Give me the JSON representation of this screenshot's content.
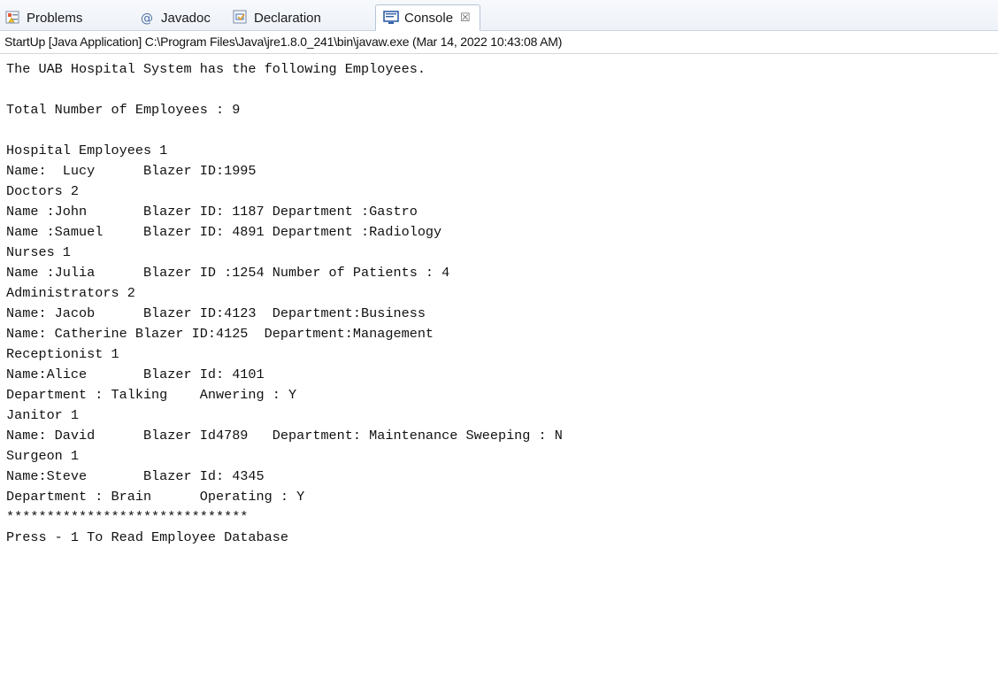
{
  "tabs": [
    {
      "label": "Problems",
      "icon": "problems-icon"
    },
    {
      "label": "Javadoc",
      "icon": "javadoc-icon"
    },
    {
      "label": "Declaration",
      "icon": "declaration-icon"
    },
    {
      "label": "Console",
      "icon": "console-icon",
      "active": true,
      "close": "☒"
    }
  ],
  "status_line": "StartUp [Java Application] C:\\Program Files\\Java\\jre1.8.0_241\\bin\\javaw.exe (Mar 14, 2022 10:43:08 AM)",
  "console_lines": [
    "The UAB Hospital System has the following Employees.",
    "",
    "Total Number of Employees : 9",
    "",
    "Hospital Employees 1",
    "Name:  Lucy      Blazer ID:1995",
    "Doctors 2",
    "Name :John       Blazer ID: 1187 Department :Gastro",
    "Name :Samuel     Blazer ID: 4891 Department :Radiology",
    "Nurses 1",
    "Name :Julia      Blazer ID :1254 Number of Patients : 4",
    "Administrators 2",
    "Name: Jacob      Blazer ID:4123  Department:Business",
    "Name: Catherine Blazer ID:4125  Department:Management",
    "Receptionist 1",
    "Name:Alice       Blazer Id: 4101",
    "Department : Talking    Anwering : Y",
    "Janitor 1",
    "Name: David      Blazer Id4789   Department: Maintenance Sweeping : N",
    "Surgeon 1",
    "Name:Steve       Blazer Id: 4345",
    "Department : Brain      Operating : Y",
    "******************************",
    "Press - 1 To Read Employee Database"
  ],
  "colors": {
    "accent_blue": "#3b6fb6",
    "tab_border": "#b8c4d6"
  }
}
